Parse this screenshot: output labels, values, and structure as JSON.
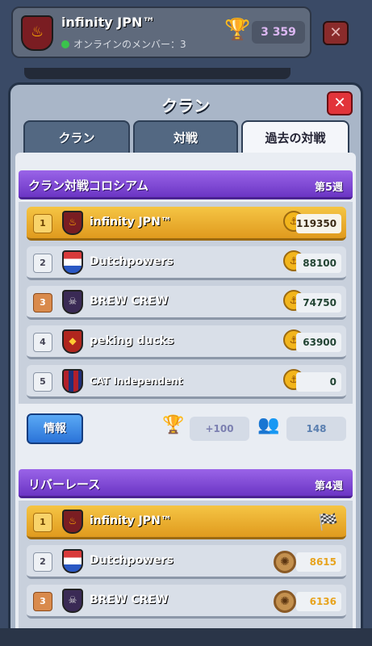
{
  "header": {
    "clan_name": "infinity JPN™",
    "online_label": "オンラインのメンバー：3",
    "trophies": "3 359",
    "close_label": "✕"
  },
  "dialog": {
    "title": "クラン",
    "close_label": "✕",
    "tabs": [
      {
        "label": "クラン"
      },
      {
        "label": "対戦"
      },
      {
        "label": "過去の対戦"
      }
    ]
  },
  "colosseum": {
    "title": "クラン対戦コロシアム",
    "week": "第5週",
    "rows": [
      {
        "rank": "1",
        "name": "infinity JPN™",
        "score": "119350"
      },
      {
        "rank": "2",
        "name": "Dutchpowers",
        "score": "88100"
      },
      {
        "rank": "3",
        "name": "BREW CREW",
        "score": "74750"
      },
      {
        "rank": "4",
        "name": "peking ducks",
        "score": "63900"
      },
      {
        "rank": "5",
        "name": "CAT Independent",
        "score": "0"
      }
    ],
    "info_label": "情報",
    "trophy_change": "+100",
    "participants": "148"
  },
  "river_race": {
    "title": "リバーレース",
    "week": "第4週",
    "rows": [
      {
        "rank": "1",
        "name": "infinity JPN™",
        "score": ""
      },
      {
        "rank": "2",
        "name": "Dutchpowers",
        "score": "8615"
      },
      {
        "rank": "3",
        "name": "BREW CREW",
        "score": "6136"
      }
    ]
  },
  "colors": {
    "gold": "#f5c544",
    "purple": "#7a45d6",
    "blue_button": "#2b73d8"
  }
}
